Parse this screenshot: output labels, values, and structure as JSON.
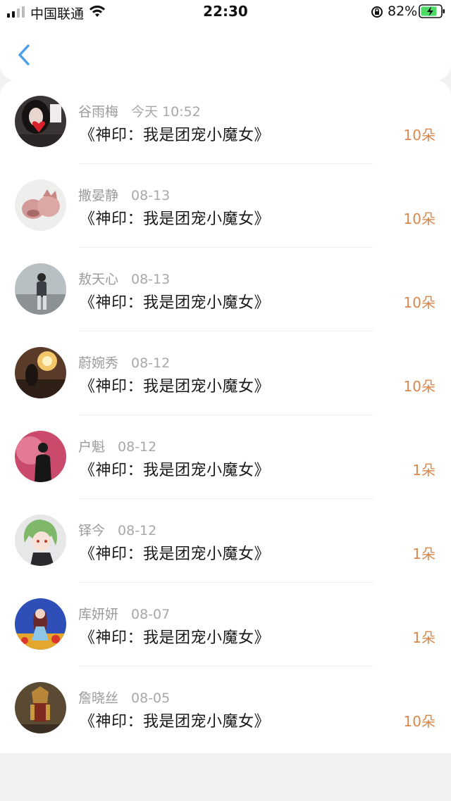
{
  "status_bar": {
    "carrier": "中国联通",
    "time": "22:30",
    "battery": "82%",
    "icons": [
      "signal-icon",
      "wifi-icon",
      "orientation-lock-icon",
      "battery-charging-icon"
    ]
  },
  "header": {
    "back_icon": "chevron-left-icon"
  },
  "colors": {
    "accent_blue": "#4a9eea",
    "count_orange": "#d8884d",
    "meta_gray": "#9b9b9b"
  },
  "items": [
    {
      "name": "谷雨梅",
      "date": "今天 10:52",
      "title": "《神印：我是团宠小魔女》",
      "count": "10朵"
    },
    {
      "name": "撒晏静",
      "date": "08-13",
      "title": "《神印：我是团宠小魔女》",
      "count": "10朵"
    },
    {
      "name": "敖天心",
      "date": "08-13",
      "title": "《神印：我是团宠小魔女》",
      "count": "10朵"
    },
    {
      "name": "蔚婉秀",
      "date": "08-12",
      "title": "《神印：我是团宠小魔女》",
      "count": "10朵"
    },
    {
      "name": "户魁",
      "date": "08-12",
      "title": "《神印：我是团宠小魔女》",
      "count": "1朵"
    },
    {
      "name": "铎今",
      "date": "08-12",
      "title": "《神印：我是团宠小魔女》",
      "count": "1朵"
    },
    {
      "name": "库妍妍",
      "date": "08-07",
      "title": "《神印：我是团宠小魔女》",
      "count": "1朵"
    },
    {
      "name": "詹晓丝",
      "date": "08-05",
      "title": "《神印：我是团宠小魔女》",
      "count": "10朵"
    }
  ]
}
